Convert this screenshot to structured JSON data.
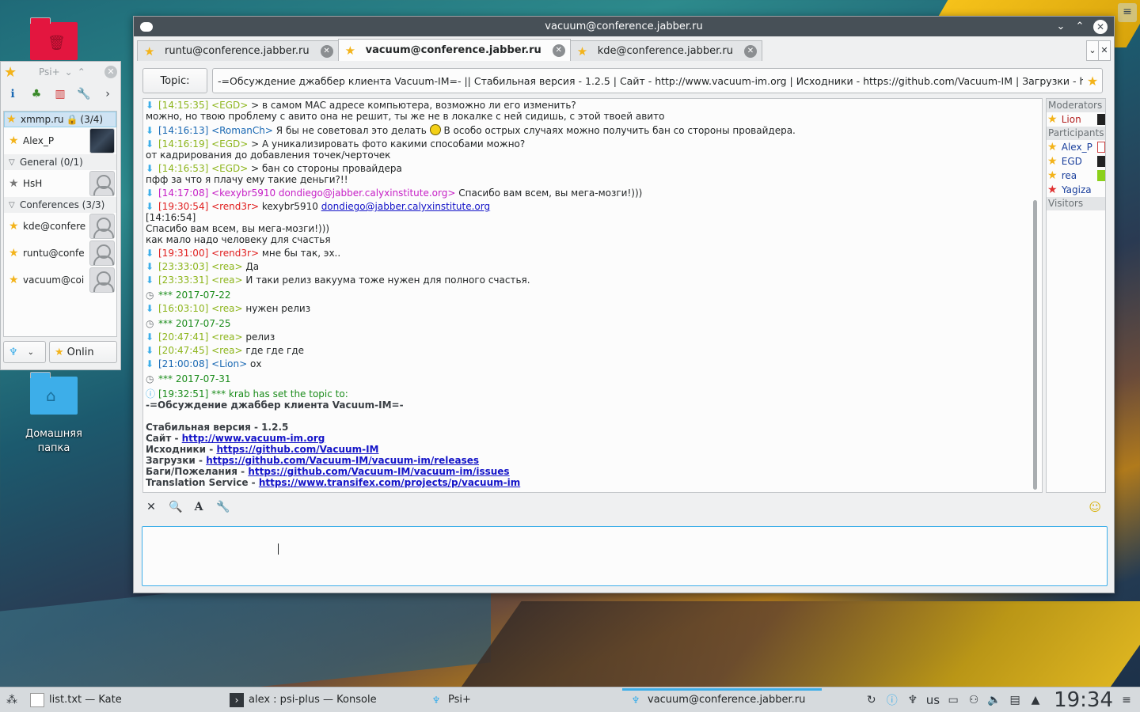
{
  "desktop": {
    "home_folder_label": "Домашняя папка"
  },
  "psi_roster": {
    "title": "Psi+",
    "account": {
      "name": "xmmp.ru",
      "count": "(3/4)"
    },
    "self_contact": "Alex_P",
    "groups": [
      {
        "name": "General (0/1)",
        "contacts": [
          "HsH"
        ]
      },
      {
        "name": "Conferences (3/3)",
        "contacts": [
          "kde@confere",
          "runtu@confe",
          "vacuum@coi"
        ]
      }
    ],
    "status_button": "Onlin"
  },
  "conference": {
    "window_title": "vacuum@conference.jabber.ru",
    "tabs": [
      "runtu@conference.jabber.ru",
      "vacuum@conference.jabber.ru",
      "kde@conference.jabber.ru"
    ],
    "active_tab": 1,
    "topic_button": "Topic:",
    "topic": "-=Обсуждение джаббер клиента Vacuum-IM=- || Стабильная версия - 1.2.5 | Сайт - http://www.vacuum-im.org | Исходники - https://github.com/Vacuum-IM | Загрузки - http",
    "messages": {
      "m1_ts": "[14:15:35] <EGD>",
      "m1_t": "> в самом МАС адресе компьютера, возможно ли его изменить?",
      "m1_t2": "можно, но твою проблему с авито она не решит, ты же не в локалке с ней сидишь, с этой твоей авито",
      "m2_ts": "[14:16:13] <RomanCh>",
      "m2_t": "Я бы не советовал это делать",
      "m2_t2": "В особо острых случаях можно получить бан со стороны провайдера.",
      "m3_ts": "[14:16:19] <EGD>",
      "m3_t": "> А уникализировать фото какими способами можно?",
      "m3_t2": "от кадрирования до добавления точек/черточек",
      "m4_ts": "[14:16:53] <EGD>",
      "m4_t": "> бан со стороны провайдера",
      "m4_t2": "пфф за что я плачу ему такие деньги?!!",
      "m5_ts": "[14:17:08] <kexybr5910 dondiego@jabber.calyxinstitute.org>",
      "m5_t": "Спасибо вам всем, вы мега-мозги!)))",
      "m6_ts": "[19:30:54] <rend3r>",
      "m6_t": "kexybr5910",
      "m6_link": "dondiego@jabber.calyxinstitute.org",
      "m6_t2": "[14:16:54]",
      "m6_t3": "Спасибо вам всем, вы мега-мозги!)))",
      "m6_t4": "как мало надо человеку для счастья",
      "m7_ts": "[19:31:00] <rend3r>",
      "m7_t": "мне бы так, эх..",
      "m8_ts": "[23:33:03] <rea>",
      "m8_t": "Да",
      "m9_ts": "[23:33:31] <rea>",
      "m9_t": "И таки релиз вакуума тоже нужен для полного счастья.",
      "d1": "*** 2017-07-22",
      "m10_ts": "[16:03:10] <rea>",
      "m10_t": "нужен релиз",
      "d2": "*** 2017-07-25",
      "m11_ts": "[20:47:41] <rea>",
      "m11_t": "релиз",
      "m12_ts": "[20:47:45] <rea>",
      "m12_t": "где где где",
      "m13_ts": "[21:00:08] <Lion>",
      "m13_t": "ох",
      "d3": "*** 2017-07-31",
      "sys_ts": "[19:32:51] *** krab has set the topic to:",
      "sys_l1": "-=Обсуждение джаббер клиента Vacuum-IM=-",
      "sys_l2": "Стабильная версия - 1.2.5",
      "sys_l3": "Сайт -",
      "sys_l3_link": "http://www.vacuum-im.org",
      "sys_l4": "Исходники -",
      "sys_l4_link": "https://github.com/Vacuum-IM",
      "sys_l5": "Загрузки -",
      "sys_l5_link": "https://github.com/Vacuum-IM/vacuum-im/releases",
      "sys_l6": "Баги/Пожелания -",
      "sys_l6_link": "https://github.com/Vacuum-IM/vacuum-im/issues",
      "sys_l7": "Translation Service -",
      "sys_l7_link": "https://www.transifex.com/projects/p/vacuum-im"
    },
    "occupants": {
      "moderators_label": "Moderators",
      "moderators": [
        "Lion"
      ],
      "participants_label": "Participants",
      "participants": [
        "Alex_P",
        "EGD",
        "rea",
        "Yagiza"
      ],
      "visitors_label": "Visitors"
    },
    "input_value": ""
  },
  "taskbar": {
    "tasks": [
      "list.txt — Kate",
      "alex : psi-plus — Konsole",
      "Psi+",
      "vacuum@conference.jabber.ru"
    ],
    "keyboard_layout": "us",
    "clock": "19:34"
  },
  "colors": {
    "accent": "#3daee9",
    "titlebar": "#475057",
    "timestamp_own": "#8db51c",
    "timestamp_other": "#1968b3",
    "timestamp_highlight": "#e01e1e",
    "system_message": "#1b8c1b"
  }
}
